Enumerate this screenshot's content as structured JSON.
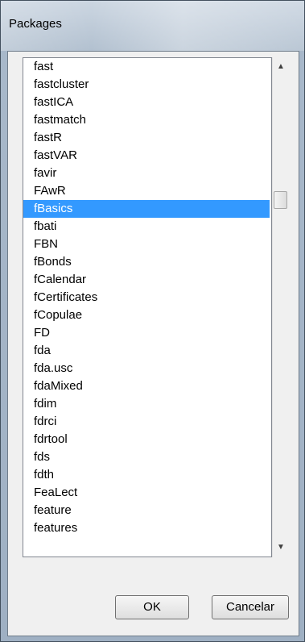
{
  "window": {
    "title": "Packages"
  },
  "list": {
    "selected_index": 8,
    "items": [
      "fast",
      "fastcluster",
      "fastICA",
      "fastmatch",
      "fastR",
      "fastVAR",
      "favir",
      "FAwR",
      "fBasics",
      "fbati",
      "FBN",
      "fBonds",
      "fCalendar",
      "fCertificates",
      "fCopulae",
      "FD",
      "fda",
      "fda.usc",
      "fdaMixed",
      "fdim",
      "fdrci",
      "fdrtool",
      "fds",
      "fdth",
      "FeaLect",
      "feature",
      "features"
    ]
  },
  "scrollbar": {
    "up_icon": "▲",
    "down_icon": "▼"
  },
  "buttons": {
    "ok_label": "OK",
    "cancel_label": "Cancelar"
  }
}
